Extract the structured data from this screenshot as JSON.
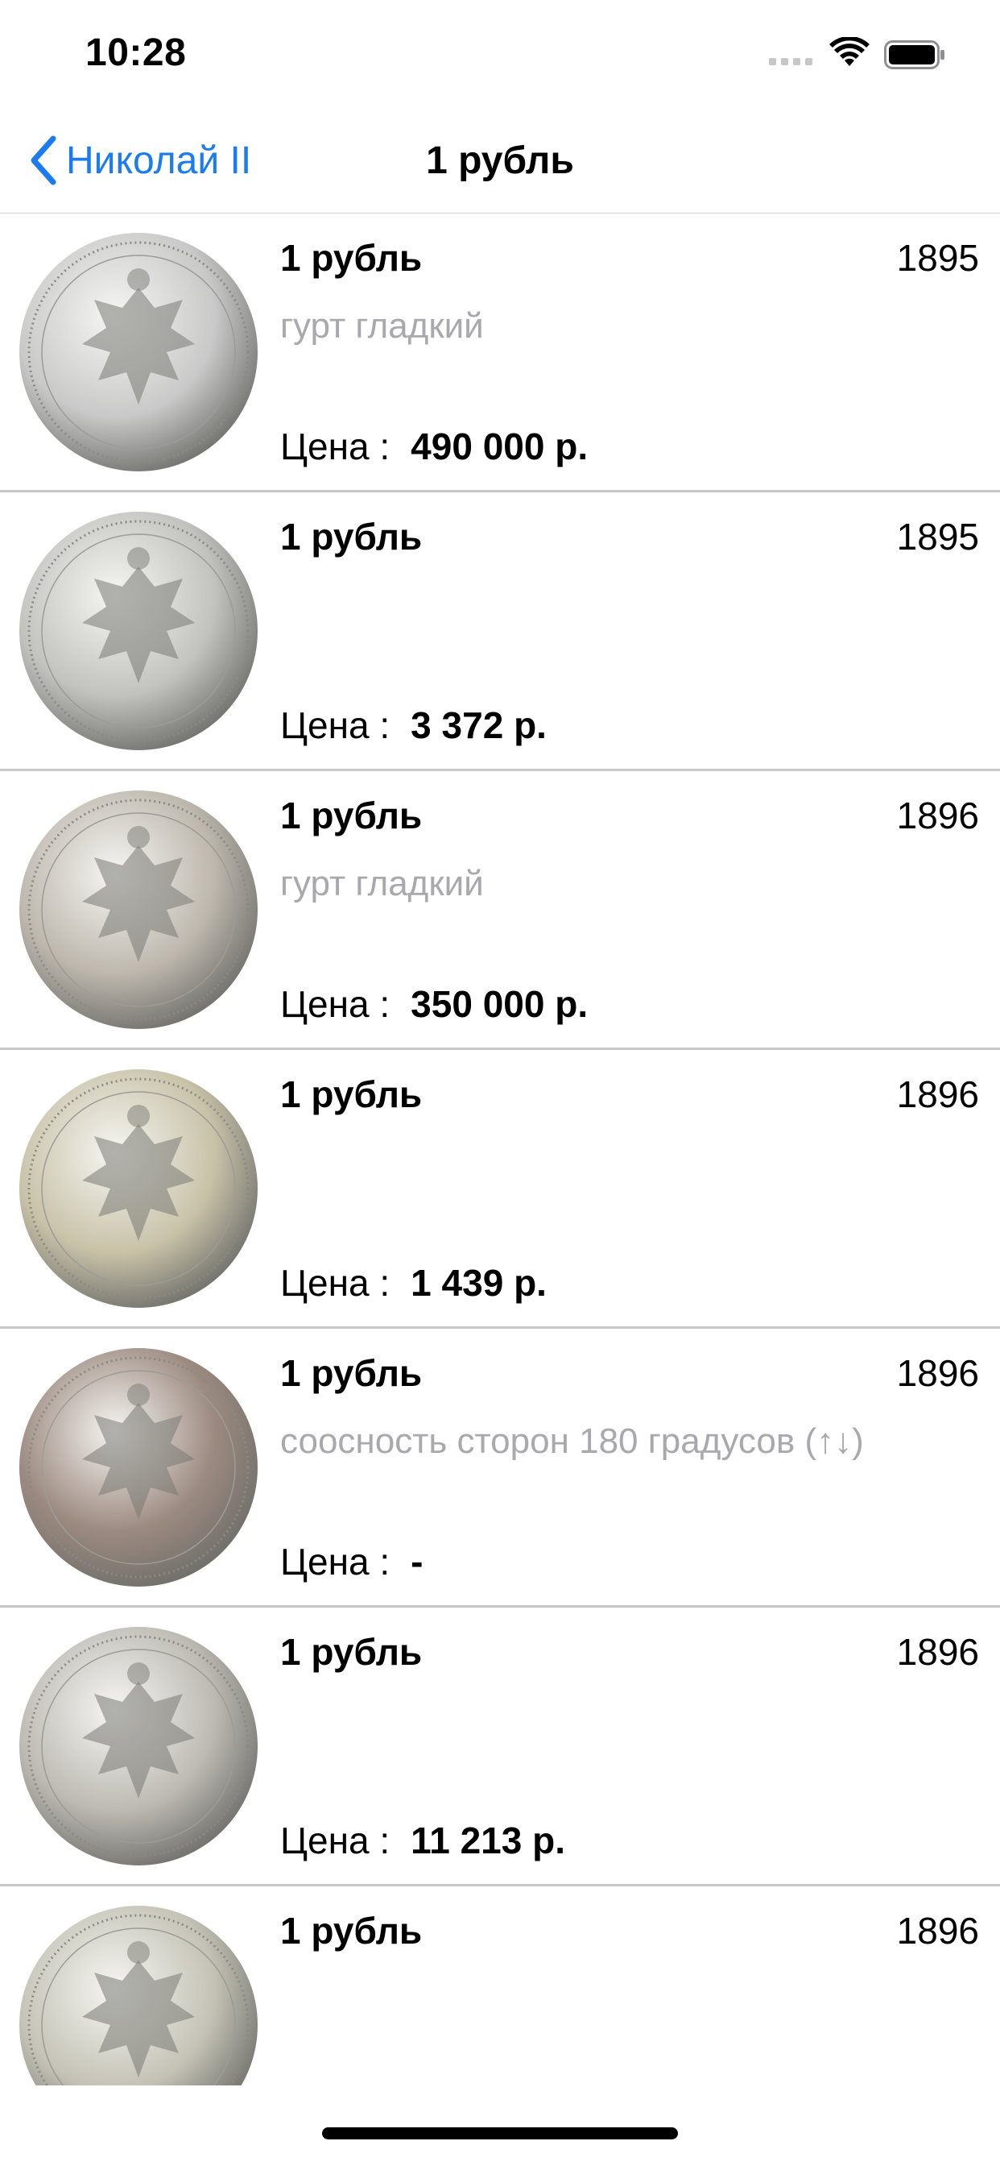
{
  "status_bar": {
    "time": "10:28",
    "icons": [
      "cellular-signal-icon",
      "wifi-icon",
      "battery-icon"
    ]
  },
  "nav": {
    "back_label": "Николай II",
    "title": "1 рубль",
    "accent_color": "#1a7cf0"
  },
  "coins": [
    {
      "name": "1 рубль",
      "year": "1895",
      "desc": "гурт гладкий",
      "price_label": "Цена :",
      "price": "490 000 р.",
      "tone": "#c9c9c9"
    },
    {
      "name": "1 рубль",
      "year": "1895",
      "desc": "",
      "price_label": "Цена :",
      "price": "3 372 р.",
      "tone": "#c2c2bf"
    },
    {
      "name": "1 рубль",
      "year": "1896",
      "desc": "гурт гладкий",
      "price_label": "Цена :",
      "price": "350 000 р.",
      "tone": "#bdb7ad"
    },
    {
      "name": "1 рубль",
      "year": "1896",
      "desc": "",
      "price_label": "Цена :",
      "price": "1 439 р.",
      "tone": "#c8c2a8"
    },
    {
      "name": "1 рубль",
      "year": "1896",
      "desc": "соосность сторон 180 градусов (↑↓)",
      "price_label": "Цена :",
      "price": "-",
      "tone": "#9c8a80"
    },
    {
      "name": "1 рубль",
      "year": "1896",
      "desc": "",
      "price_label": "Цена :",
      "price": "11 213 р.",
      "tone": "#bdbab3"
    },
    {
      "name": "1 рубль",
      "year": "1896",
      "desc": "",
      "price_label": "Цена :",
      "price": "",
      "tone": "#c4c2b5"
    }
  ]
}
